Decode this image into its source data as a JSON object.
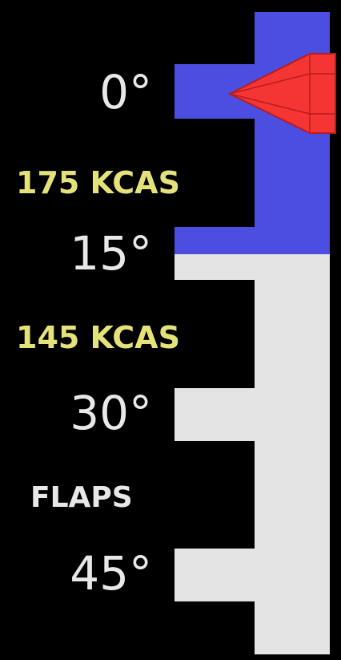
{
  "panel": {
    "title": "FLAPS",
    "detents": [
      {
        "label": "0°"
      },
      {
        "label": "15°"
      },
      {
        "label": "30°"
      },
      {
        "label": "45°"
      }
    ],
    "speed_limits": [
      {
        "label": "175 KCAS"
      },
      {
        "label": "145 KCAS"
      }
    ]
  },
  "indicator": {
    "selected_detent": "0°",
    "extended_range": [
      "0°",
      "15°"
    ]
  },
  "colors": {
    "background": "#000000",
    "detent_text": "#e8e8e8",
    "speed_text": "#e6e27a",
    "extended_range_fill": "#4b4ee0",
    "track_fill": "#e4e4e4",
    "pointer_fill": "#f53434",
    "pointer_stroke": "#b81c1c"
  }
}
